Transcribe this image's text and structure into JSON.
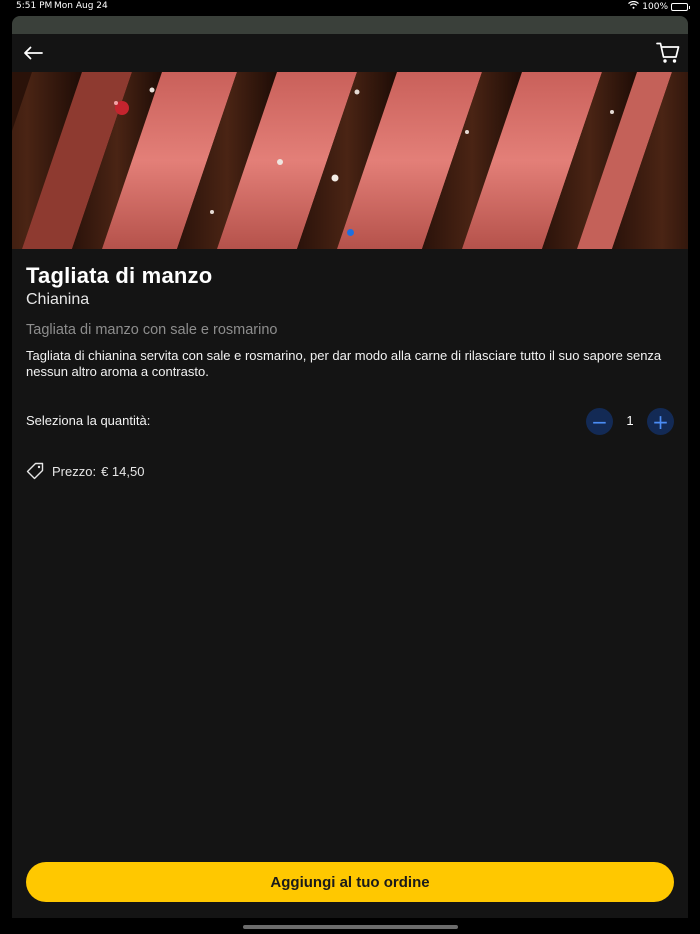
{
  "status_bar": {
    "time": "5:51 PM",
    "date": "Mon Aug 24",
    "battery": "100%",
    "icons": [
      "wifi-icon",
      "battery-icon"
    ]
  },
  "nav": {
    "back_icon": "arrow-left-icon",
    "cart_icon": "cart-icon"
  },
  "hero": {
    "carousel_page_index": 1,
    "carousel_page_count": 1,
    "accent": "#1e6fe0"
  },
  "product": {
    "name": "Tagliata di manzo",
    "subtitle": "Chianina",
    "short_description": "Tagliata di manzo con sale e rosmarino",
    "description": "Tagliata di chianina servita con sale e rosmarino, per dar modo alla carne di rilasciare tutto il suo sapore senza nessun altro aroma a contrasto."
  },
  "quantity": {
    "label": "Seleziona la quantità:",
    "value": "1",
    "minus_symbol": "−",
    "plus_symbol": "+"
  },
  "price": {
    "icon": "price-tag-icon",
    "label": "Prezzo:",
    "value": "€ 14,50"
  },
  "cta": {
    "label": "Aggiungi al tuo ordine",
    "color": "#ffc800"
  }
}
